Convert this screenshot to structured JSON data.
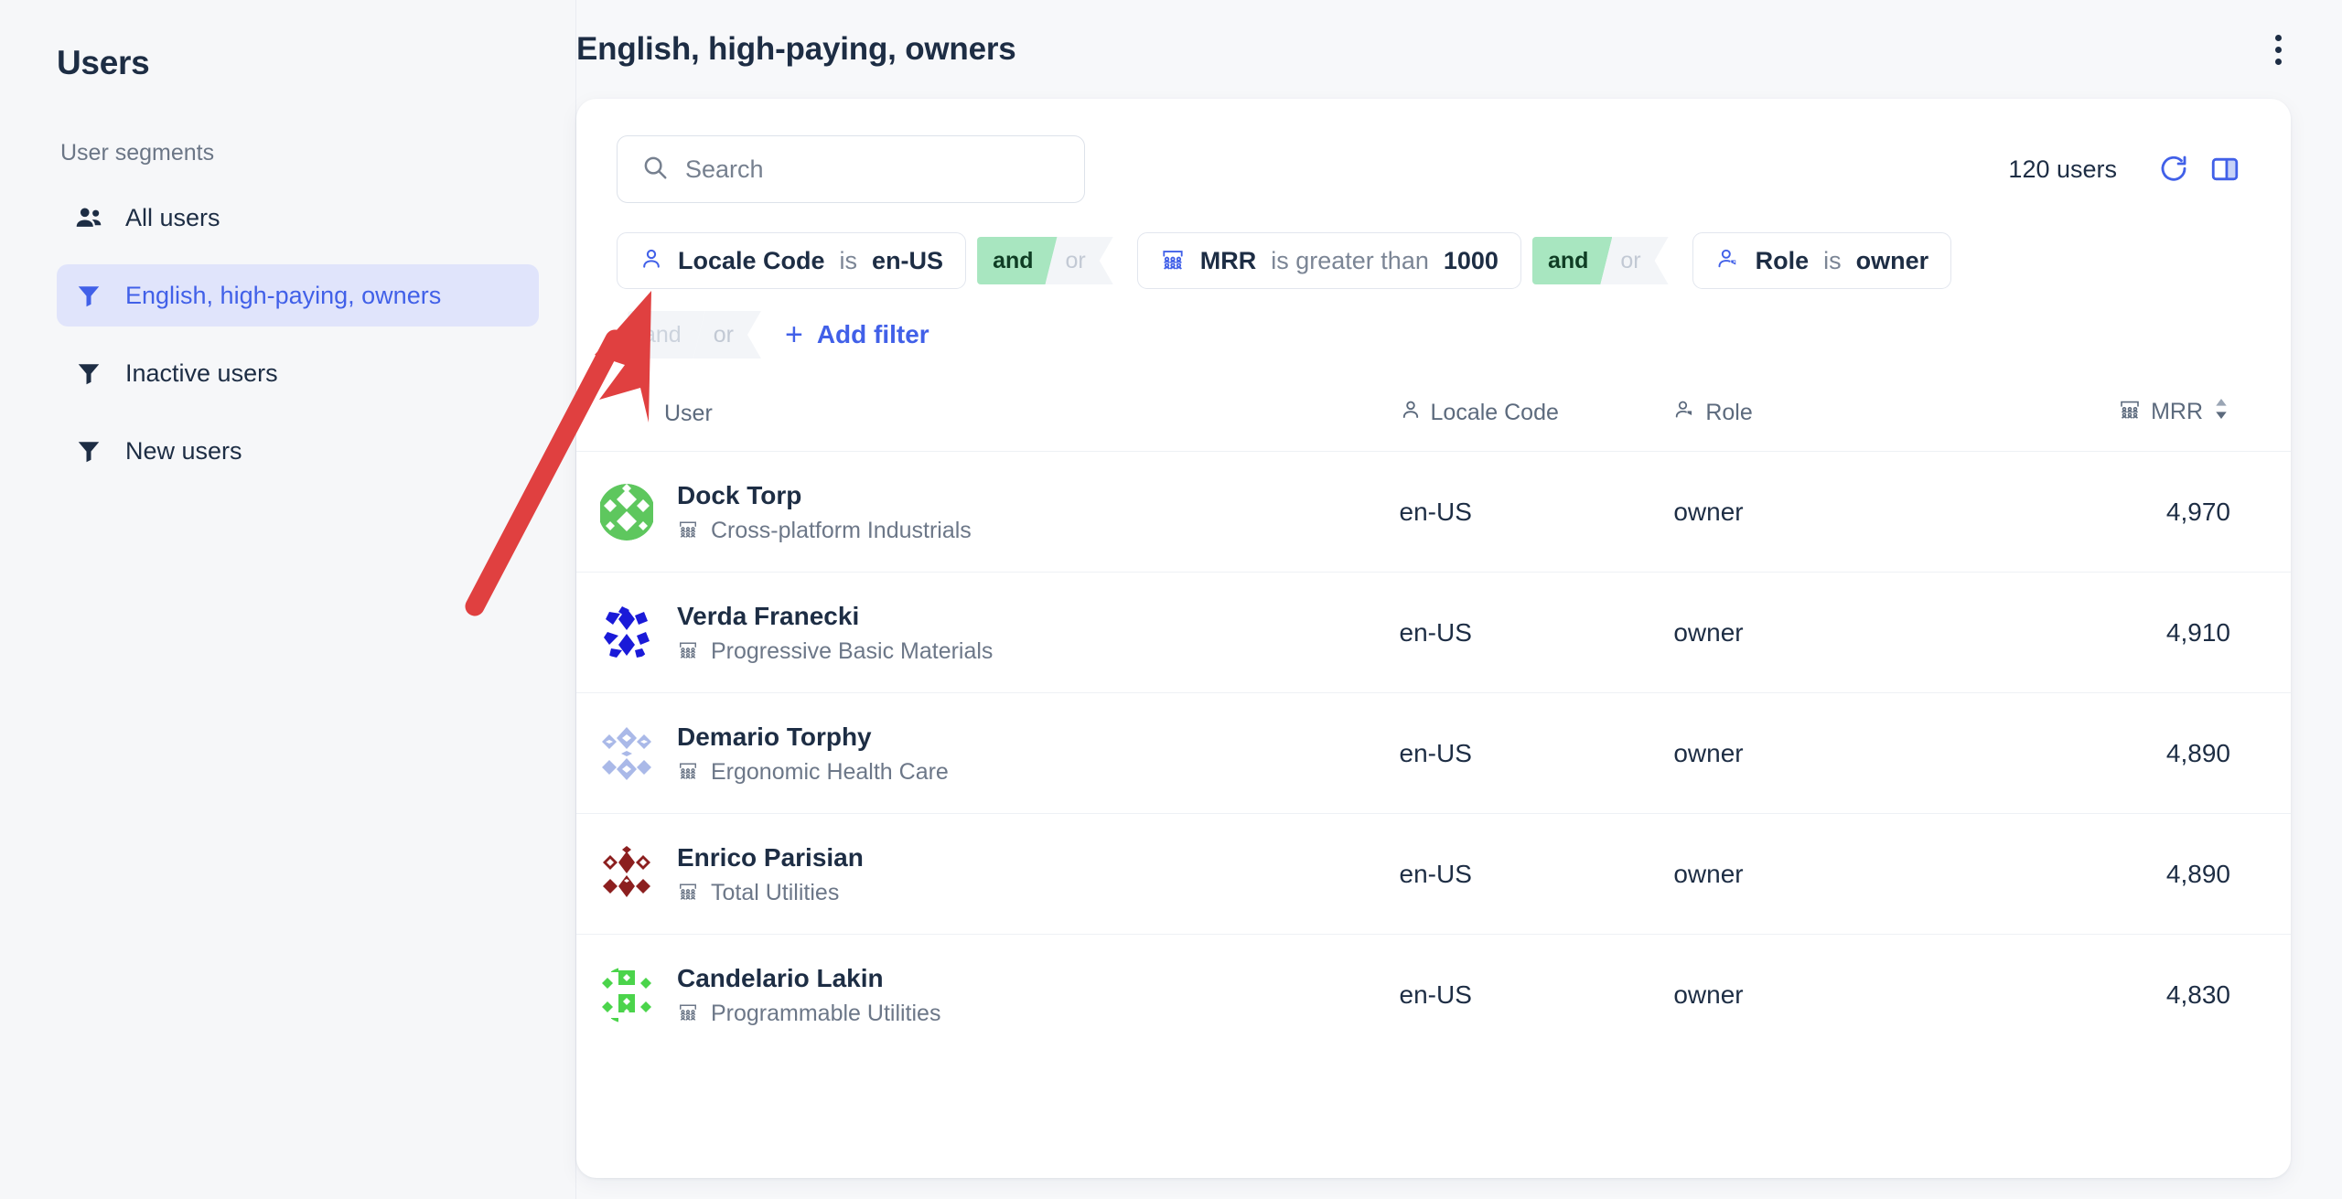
{
  "sidebar": {
    "title": "Users",
    "section_label": "User segments",
    "items": [
      {
        "label": "All users",
        "icon": "users-group-icon",
        "active": false
      },
      {
        "label": "English, high-paying, owners",
        "icon": "filter-icon",
        "active": true
      },
      {
        "label": "Inactive users",
        "icon": "filter-icon",
        "active": false
      },
      {
        "label": "New users",
        "icon": "filter-icon",
        "active": false
      }
    ]
  },
  "header": {
    "title": "English, high-paying, owners",
    "menu_icon": "kebab-menu-icon"
  },
  "toolbar": {
    "search_placeholder": "Search",
    "search_value": "",
    "search_icon": "search-icon",
    "users_count": "120 users",
    "refresh_icon": "refresh-icon",
    "columns_icon": "columns-layout-icon"
  },
  "filters": {
    "pills": [
      {
        "icon": "person-icon",
        "field": "Locale Code",
        "operator": "is",
        "value": "en-US"
      },
      {
        "icon": "company-icon",
        "field": "MRR",
        "operator": "is greater than",
        "value": "1000"
      },
      {
        "icon": "person-tag-icon",
        "field": "Role",
        "operator": "is",
        "value": "owner"
      }
    ],
    "conjunctions": [
      {
        "and_label": "and",
        "or_label": "or",
        "active": "and"
      },
      {
        "and_label": "and",
        "or_label": "or",
        "active": "and"
      }
    ],
    "add_row": {
      "and_label": "and",
      "or_label": "or",
      "active": "none",
      "plus_icon": "plus-icon",
      "add_label": "Add filter"
    }
  },
  "table": {
    "columns": [
      {
        "label": "User",
        "icon": null,
        "sort": null
      },
      {
        "label": "Locale Code",
        "icon": "person-icon",
        "sort": null
      },
      {
        "label": "Role",
        "icon": "person-tag-icon",
        "sort": null
      },
      {
        "label": "MRR",
        "icon": "company-icon",
        "sort": "sort-arrows-icon"
      }
    ],
    "rows": [
      {
        "name": "Dock Torp",
        "company": "Cross-platform Industrials",
        "locale": "en-US",
        "role": "owner",
        "mrr": "4,970",
        "avatar_color": "#5ec75e",
        "avatar_pattern": "diamond"
      },
      {
        "name": "Verda Franecki",
        "company": "Progressive Basic Materials",
        "locale": "en-US",
        "role": "owner",
        "mrr": "4,910",
        "avatar_color": "#1a1ad8",
        "avatar_pattern": "shard"
      },
      {
        "name": "Demario Torphy",
        "company": "Ergonomic Health Care",
        "locale": "en-US",
        "role": "owner",
        "mrr": "4,890",
        "avatar_color": "#aab9e8",
        "avatar_pattern": "lattice"
      },
      {
        "name": "Enrico Parisian",
        "company": "Total Utilities",
        "locale": "en-US",
        "role": "owner",
        "mrr": "4,890",
        "avatar_color": "#8c1f1f",
        "avatar_pattern": "diamond"
      },
      {
        "name": "Candelario Lakin",
        "company": "Programmable Utilities",
        "locale": "en-US",
        "role": "owner",
        "mrr": "4,830",
        "avatar_color": "#4bd44b",
        "avatar_pattern": "speckle"
      }
    ]
  },
  "annotation": {
    "arrow_color": "#e04040",
    "arrow_target": "locale-code-filter-pill"
  },
  "colors": {
    "accent": "#4160e8",
    "text": "#1d2d44",
    "muted": "#6c7788",
    "and_green": "#a8e6c0",
    "card_bg": "#ffffff",
    "page_bg": "#f6f7f9"
  }
}
